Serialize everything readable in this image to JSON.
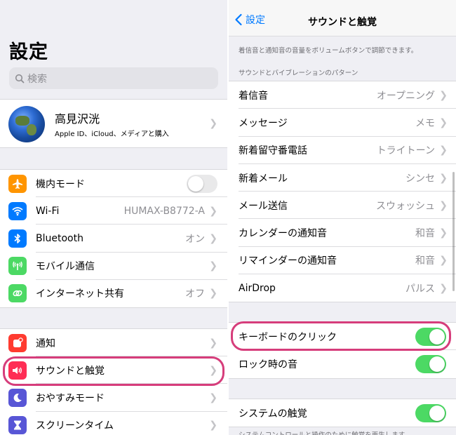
{
  "left": {
    "title": "設定",
    "search_placeholder": "検索",
    "profile": {
      "name": "高見沢洸",
      "subtitle": "Apple ID、iCloud、メディアと購入"
    },
    "group1": [
      {
        "label": "機内モード",
        "icon": "airplane-icon",
        "color": "#ff9500",
        "toggle": "off"
      },
      {
        "label": "Wi-Fi",
        "value": "HUMAX-B8772-A",
        "icon": "wifi-icon",
        "color": "#007aff"
      },
      {
        "label": "Bluetooth",
        "value": "オン",
        "icon": "bluetooth-icon",
        "color": "#007aff"
      },
      {
        "label": "モバイル通信",
        "icon": "antenna-icon",
        "color": "#4cd964"
      },
      {
        "label": "インターネット共有",
        "value": "オフ",
        "icon": "link-icon",
        "color": "#4cd964"
      }
    ],
    "group2": [
      {
        "label": "通知",
        "icon": "notification-icon",
        "color": "#ff3b30"
      },
      {
        "label": "サウンドと触覚",
        "icon": "speaker-icon",
        "color": "#ff2d55"
      },
      {
        "label": "おやすみモード",
        "icon": "moon-icon",
        "color": "#5856d6"
      },
      {
        "label": "スクリーンタイム",
        "icon": "hourglass-icon",
        "color": "#5856d6"
      }
    ]
  },
  "right": {
    "back_label": "設定",
    "title": "サウンドと触覚",
    "caption_top": "着信音と通知音の音量をボリュームボタンで調節できます。",
    "section_header": "サウンドとバイブレーションのパターン",
    "patterns": [
      {
        "label": "着信音",
        "value": "オープニング"
      },
      {
        "label": "メッセージ",
        "value": "メモ"
      },
      {
        "label": "新着留守番電話",
        "value": "トライトーン"
      },
      {
        "label": "新着メール",
        "value": "シンセ"
      },
      {
        "label": "メール送信",
        "value": "スウォッシュ"
      },
      {
        "label": "カレンダーの通知音",
        "value": "和音"
      },
      {
        "label": "リマインダーの通知音",
        "value": "和音"
      },
      {
        "label": "AirDrop",
        "value": "パルス"
      }
    ],
    "toggles": [
      {
        "label": "キーボードのクリック",
        "state": "on"
      },
      {
        "label": "ロック時の音",
        "state": "on"
      }
    ],
    "haptics": {
      "label": "システムの触覚",
      "state": "on"
    },
    "caption_bottom": "システムコントロールと操作のために触覚を再生します。"
  },
  "colors": {
    "highlight": "#d63d7b",
    "toggle_on": "#4cd964",
    "link": "#007aff"
  }
}
